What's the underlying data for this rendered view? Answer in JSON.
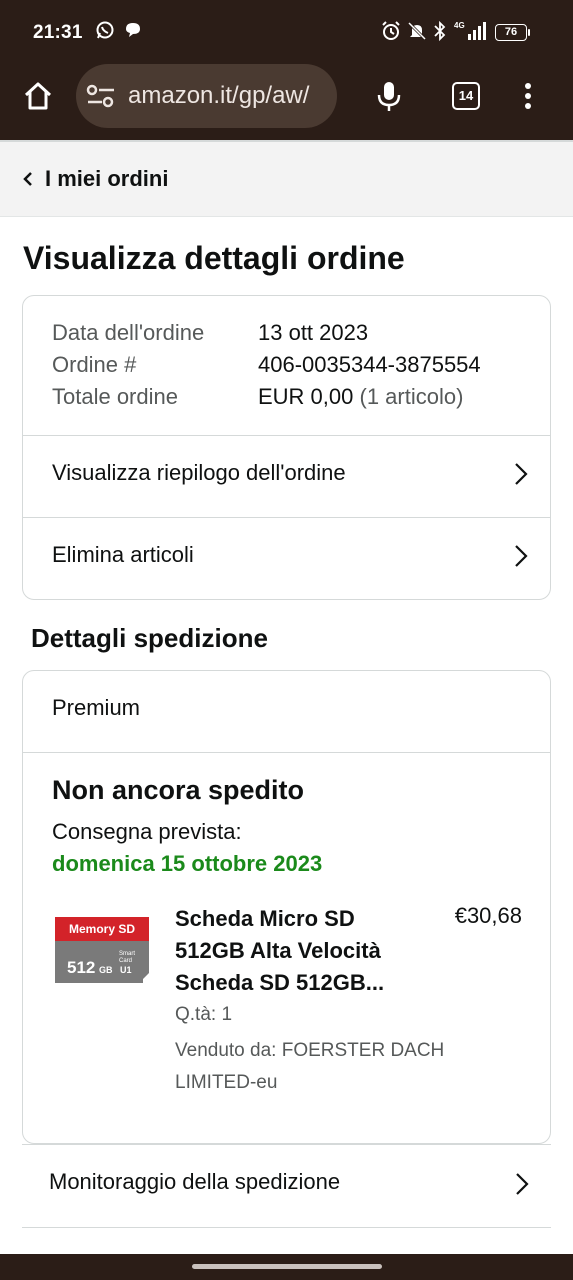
{
  "status_bar": {
    "time": "21:31",
    "battery": "76",
    "left_icons": [
      "whatsapp-icon",
      "message-bubble-icon"
    ],
    "right_icons": [
      "alarm-icon",
      "silent-bell-icon",
      "bluetooth-icon",
      "signal-4g-icon",
      "battery-icon"
    ]
  },
  "browser": {
    "url": "amazon.it/gp/aw/",
    "tab_count": "14",
    "icons": [
      "home-icon",
      "site-settings-icon",
      "microphone-icon",
      "tabs-icon",
      "more-vert-icon"
    ]
  },
  "breadcrumb": {
    "label": "I miei ordini"
  },
  "page": {
    "title": "Visualizza dettagli ordine"
  },
  "order_summary": {
    "rows": [
      {
        "label": "Data dell'ordine",
        "value": "13 ott 2023",
        "extra": ""
      },
      {
        "label": "Ordine #",
        "value": "406-0035344-3875554",
        "extra": ""
      },
      {
        "label": "Totale ordine",
        "value": "EUR 0,00",
        "extra": " (1 articolo)"
      }
    ],
    "links": [
      {
        "label": "Visualizza riepilogo dell'ordine"
      },
      {
        "label": "Elimina articoli"
      }
    ]
  },
  "shipment": {
    "section_title": "Dettagli spedizione",
    "tier": "Premium",
    "status": "Non ancora spedito",
    "delivery_label": "Consegna prevista:",
    "delivery_date": "domenica 15 ottobre 2023",
    "item": {
      "title": "Scheda Micro SD 512GB Alta Velocità Scheda SD 512GB...",
      "price": "€30,68",
      "qty": "Q.tà: 1",
      "seller": "Venduto da: FOERSTER DACH LIMITED-eu",
      "image_text": {
        "brand": "Memory SD",
        "capacity": "512",
        "unit": "GB",
        "smart": "Smart",
        "card": "Card",
        "u": "U1"
      }
    },
    "tracking_label": "Monitoraggio della spedizione"
  },
  "colors": {
    "chrome_bg": "#2b1d17",
    "url_pill": "#4a3a31",
    "delivery_green": "#1b8a1b",
    "card_border": "#d5d9d9",
    "breadcrumb_bg": "#f3f3f3"
  }
}
